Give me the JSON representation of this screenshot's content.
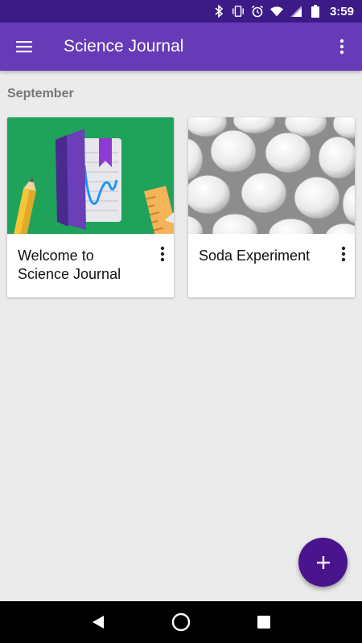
{
  "status_bar": {
    "time": "3:59",
    "icons": [
      "bluetooth-icon",
      "vibrate-icon",
      "alarm-icon",
      "wifi-icon",
      "signal-icon",
      "battery-icon"
    ]
  },
  "app_bar": {
    "title": "Science Journal",
    "menu_icon": "hamburger-menu-icon",
    "overflow_icon": "more-vert-icon",
    "background": "#673ab7"
  },
  "section": {
    "header": "September"
  },
  "experiments": [
    {
      "title": "Welcome to Science Journal",
      "thumbnail": "welcome-notebook-illustration"
    },
    {
      "title": "Soda Experiment",
      "thumbnail": "white-candies-photo"
    }
  ],
  "fab": {
    "icon": "plus-icon",
    "color": "#4a148c"
  },
  "nav_bar": {
    "icons": [
      "back-icon",
      "home-icon",
      "recents-icon"
    ]
  },
  "colors": {
    "status_bar": "#3c1b87",
    "accent": "#673ab7",
    "page_bg": "#ebebeb",
    "welcome_thumb_bg": "#1fa35b"
  }
}
